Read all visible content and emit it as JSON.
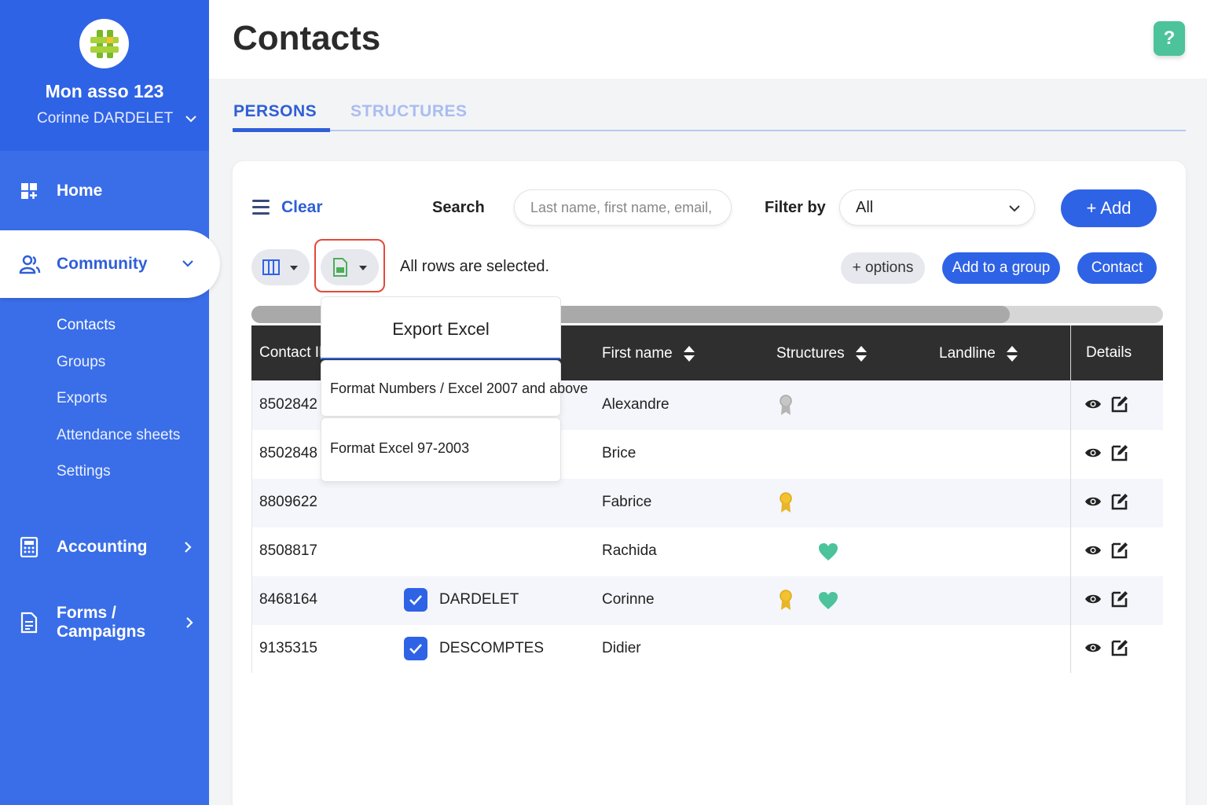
{
  "sidebar": {
    "org_name": "Mon asso 123",
    "user_name": "Corinne DARDELET",
    "nav": {
      "home": "Home",
      "community": "Community",
      "accounting": "Accounting",
      "forms": "Forms / Campaigns"
    },
    "subnav": [
      "Contacts",
      "Groups",
      "Exports",
      "Attendance sheets",
      "Settings"
    ],
    "colors": {
      "background": "#3a6ee8",
      "header": "#2f63e6",
      "active_text": "#2f5fd6"
    }
  },
  "page": {
    "title": "Contacts",
    "help": "?",
    "tabs": [
      "PERSONS",
      "STRUCTURES"
    ],
    "active_tab": "PERSONS"
  },
  "toolbar": {
    "clear": "Clear",
    "search_label": "Search",
    "search_placeholder": "Last name, first name, email, ...",
    "filter_label": "Filter by",
    "filter_value": "All",
    "add": "+ Add",
    "selection_status": "All rows are selected.",
    "options": "+ options",
    "add_to_group": "Add to a group",
    "contact": "Contact"
  },
  "export_menu": {
    "title": "Export Excel",
    "items": [
      "Format Numbers / Excel 2007 and above",
      "Format Excel 97-2003"
    ]
  },
  "table": {
    "columns": {
      "contact_id": "Contact ID",
      "first_name": "First name",
      "structures": "Structures",
      "landline": "Landline",
      "details": "Details"
    },
    "rows": [
      {
        "id": "8502842",
        "checked": false,
        "last_name": "",
        "first_name": "Alexandre",
        "badges": [
          "gray-ribbon-icon"
        ]
      },
      {
        "id": "8502848",
        "checked": false,
        "last_name": "",
        "first_name": "Brice",
        "badges": []
      },
      {
        "id": "8809622",
        "checked": false,
        "last_name": "",
        "first_name": "Fabrice",
        "badges": [
          "gold-ribbon-icon"
        ]
      },
      {
        "id": "8508817",
        "checked": false,
        "last_name": "",
        "first_name": "Rachida",
        "badges": [
          "heart-icon"
        ]
      },
      {
        "id": "8468164",
        "checked": true,
        "last_name": "DARDELET",
        "first_name": "Corinne",
        "badges": [
          "gold-ribbon-icon",
          "heart-icon"
        ]
      },
      {
        "id": "9135315",
        "checked": true,
        "last_name": "DESCOMPTES",
        "first_name": "Didier",
        "badges": []
      }
    ],
    "colors": {
      "header": "#2f2f2f",
      "heart": "#4cc39a",
      "gold": "#f2c230",
      "gray": "#b5b5b5"
    }
  }
}
